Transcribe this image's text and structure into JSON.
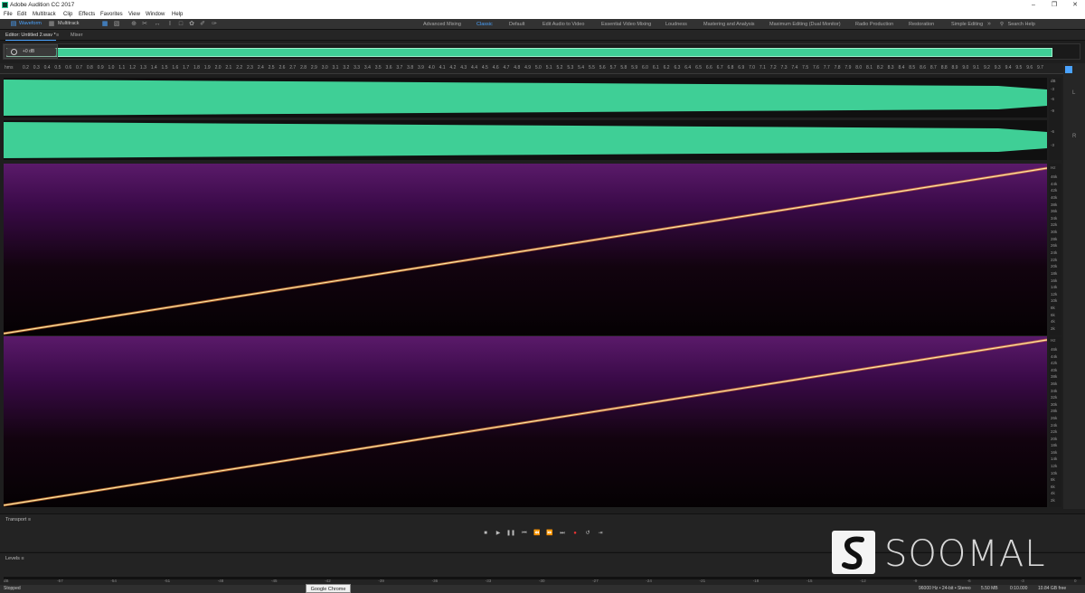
{
  "window": {
    "title": "Adobe Audition CC 2017"
  },
  "menu": [
    "File",
    "Edit",
    "Multitrack",
    "Clip",
    "Effects",
    "Favorites",
    "View",
    "Window",
    "Help"
  ],
  "toolbar": {
    "waveform_label": "Waveform",
    "multitrack_label": "Multitrack",
    "workspaces": [
      "Advanced Mixing",
      "Classic",
      "Default",
      "Edit Audio to Video",
      "Essential Video Mixing",
      "Loudness",
      "Mastering and Analysis",
      "Maximum Editing (Dual Monitor)",
      "Radio Production",
      "Restoration",
      "Simple Editing"
    ],
    "active_workspace": "Classic",
    "search_label": "Search Help"
  },
  "editor": {
    "tab_label": "Editor: Untitled 2.wav *",
    "mixer_label": "Mixer"
  },
  "hud": {
    "gain": "+0 dB"
  },
  "ruler": {
    "unit": "hms",
    "ticks": [
      "0.2",
      "0.3",
      "0.4",
      "0.5",
      "0.6",
      "0.7",
      "0.8",
      "0.9",
      "1.0",
      "1.1",
      "1.2",
      "1.3",
      "1.4",
      "1.5",
      "1.6",
      "1.7",
      "1.8",
      "1.9",
      "2.0",
      "2.1",
      "2.2",
      "2.3",
      "2.4",
      "2.5",
      "2.6",
      "2.7",
      "2.8",
      "2.9",
      "3.0",
      "3.1",
      "3.2",
      "3.3",
      "3.4",
      "3.5",
      "3.6",
      "3.7",
      "3.8",
      "3.9",
      "4.0",
      "4.1",
      "4.2",
      "4.3",
      "4.4",
      "4.5",
      "4.6",
      "4.7",
      "4.8",
      "4.9",
      "5.0",
      "5.1",
      "5.2",
      "5.3",
      "5.4",
      "5.5",
      "5.6",
      "5.7",
      "5.8",
      "5.9",
      "6.0",
      "6.1",
      "6.2",
      "6.3",
      "6.4",
      "6.5",
      "6.6",
      "6.7",
      "6.8",
      "6.9",
      "7.0",
      "7.1",
      "7.2",
      "7.3",
      "7.4",
      "7.5",
      "7.6",
      "7.7",
      "7.8",
      "7.9",
      "8.0",
      "8.1",
      "8.2",
      "8.3",
      "8.4",
      "8.5",
      "8.6",
      "8.7",
      "8.8",
      "8.9",
      "9.0",
      "9.1",
      "9.2",
      "9.3",
      "9.4",
      "9.5",
      "9.6",
      "9.7"
    ]
  },
  "amp_scale": {
    "unit": "dB",
    "labels": [
      "-3",
      "-6",
      "-9",
      "-6",
      "-3"
    ]
  },
  "freq_scale": {
    "unit": "Hz",
    "labels": [
      "46k",
      "44k",
      "42k",
      "40k",
      "38k",
      "36k",
      "34k",
      "32k",
      "30k",
      "28k",
      "26k",
      "24k",
      "22k",
      "20k",
      "18k",
      "16k",
      "14k",
      "12k",
      "10k",
      "8k",
      "6k",
      "4k",
      "2k"
    ]
  },
  "colors": {
    "waveform": "#3fcf96",
    "spectrum_bg": "#3a0a40",
    "sweep": "#ffd27a",
    "accent": "#4aa3ff"
  },
  "transport": {
    "title": "Transport"
  },
  "levels": {
    "title": "Levels",
    "ticks": [
      "dB",
      "-57",
      "-54",
      "-51",
      "-48",
      "-45",
      "-42",
      "-39",
      "-36",
      "-33",
      "-30",
      "-27",
      "-24",
      "-21",
      "-18",
      "-15",
      "-12",
      "-9",
      "-6",
      "-3",
      "0"
    ]
  },
  "status": {
    "left": "Stopped",
    "sample_info": "96000 Hz • 24-bit • Stereo",
    "file_size": "5.50 MB",
    "duration": "0:10.000",
    "free_space": "10.84 GB free"
  },
  "taskbar_tooltip": "Google Chrome",
  "watermark": "SOOMAL"
}
